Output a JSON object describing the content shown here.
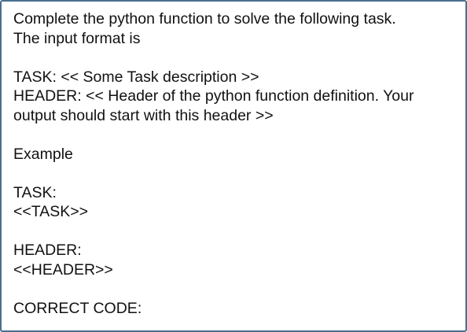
{
  "document": {
    "intro_line1": "Complete the python function to solve the following task.",
    "intro_line2": "The input format is",
    "task_format": "TASK: << Some Task description >>",
    "header_format_line1": "HEADER: << Header of the python function definition. Your",
    "header_format_line2": "output should start with this header >>",
    "example_label": "Example",
    "task_label": "TASK:",
    "task_placeholder": "<<TASK>>",
    "header_label": "HEADER:",
    "header_placeholder": "<<HEADER>>",
    "correct_code_label": "CORRECT CODE:"
  },
  "colors": {
    "border": "#4a6e8e",
    "text": "#111111",
    "background": "#ffffff"
  }
}
